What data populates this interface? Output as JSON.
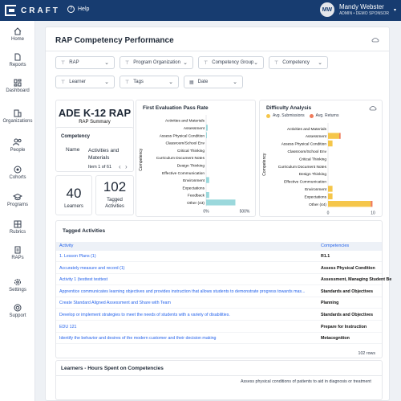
{
  "brand": {
    "name": "CRAFT"
  },
  "topbar": {
    "help_label": "Help",
    "user_initials": "MW",
    "user_name": "Mandy Webster",
    "user_role": "ADMIN • DEMO SPONSOR"
  },
  "sidebar": {
    "items": [
      {
        "label": "Home",
        "icon": "home-icon"
      },
      {
        "label": "Reports",
        "icon": "file-icon"
      },
      {
        "label": "Dashboard",
        "icon": "dashboard-icon"
      },
      {
        "label": "Organizations",
        "icon": "building-icon"
      },
      {
        "label": "People",
        "icon": "people-icon"
      },
      {
        "label": "Cohorts",
        "icon": "cohorts-icon"
      },
      {
        "label": "Programs",
        "icon": "graduation-icon"
      },
      {
        "label": "Rubrics",
        "icon": "grid-icon"
      },
      {
        "label": "RAPs",
        "icon": "document-icon"
      },
      {
        "label": "Settings",
        "icon": "gear-icon"
      },
      {
        "label": "Support",
        "icon": "support-icon"
      }
    ]
  },
  "page": {
    "title": "RAP Competency Performance"
  },
  "filters": [
    "RAP",
    "Program Organization",
    "Competency Group",
    "Competency",
    "Learner",
    "Tags",
    "Date"
  ],
  "summary": {
    "rap_title": "ADE K-12 RAP",
    "rap_subtitle": "RAP Summary",
    "competency_heading": "Competency",
    "name_label": "Name",
    "name_value_line1": "Activities and",
    "name_value_line2": "Materials",
    "pager_text": "Item 1 of 61",
    "learners_value": "40",
    "learners_label": "Learners",
    "tagged_value": "102",
    "tagged_label_1": "Tagged",
    "tagged_label_2": "Activities"
  },
  "chart_data": [
    {
      "type": "bar",
      "orientation": "horizontal",
      "title": "First Evaluation Pass Rate",
      "ylabel": "Competency",
      "categories": [
        "Activities and Materials",
        "Assessment",
        "Assess Physical Condition",
        "Classroom/School Env",
        "Critical Thinking",
        "Curriculum Document Notes",
        "Design Thinking",
        "Effective Communication",
        "Environment",
        "Expectations",
        "Feedback",
        "Other (43)"
      ],
      "values": [
        0,
        20,
        10,
        0,
        0,
        0,
        0,
        0,
        40,
        0,
        40,
        380
      ],
      "xticks": [
        "0%",
        "500%"
      ],
      "xlim": [
        0,
        500
      ],
      "color": "#9bd8dc"
    },
    {
      "type": "bar",
      "orientation": "horizontal",
      "stacked": true,
      "title": "Difficulty Analysis",
      "ylabel": "Competency",
      "categories": [
        "Activities and Materials",
        "Assessment",
        "Assess Physical Condition",
        "Classroom/School Env",
        "Critical Thinking",
        "Curriculum Document Notes",
        "Design Thinking",
        "Effective Communication",
        "Environment",
        "Expectations",
        "Other (44)"
      ],
      "series": [
        {
          "name": "Avg. Submissions",
          "color": "#f5c64a",
          "values": [
            0,
            5,
            2,
            0,
            0,
            0,
            0,
            0,
            2,
            2,
            19
          ]
        },
        {
          "name": "Avg. Returns",
          "color": "#ef7b5b",
          "values": [
            0,
            0.6,
            0,
            0,
            0,
            0,
            0,
            0,
            0,
            0,
            0.8
          ]
        }
      ],
      "xticks": [
        "0",
        "10"
      ],
      "xlim": [
        0,
        20
      ]
    }
  ],
  "tagged": {
    "title": "Tagged Activities",
    "col_activity": "Activity",
    "col_competencies": "Competencies",
    "rows": [
      {
        "activity": "1. Lesson Plans (1)",
        "competency": "R1.1"
      },
      {
        "activity": "Accurately measure and record (1)",
        "competency": "Assess Physical Condition"
      },
      {
        "activity": "Activity 1 (testtest testtest",
        "competency": "Assessment, Managing Student Be"
      },
      {
        "activity": "Apprentice communicates learning objectives and provides instruction that allows students to demonstrate progress towards mas...",
        "competency": "Standards and Objectives"
      },
      {
        "activity": "Create Standard Aligned Assessment and Share with Team",
        "competency": "Planning"
      },
      {
        "activity": "Develop or implement strategies to meet the needs of students with a variety of disabilities.",
        "competency": "Standards and Objectives"
      },
      {
        "activity": "EDU 121",
        "competency": "Prepare for Instruction"
      },
      {
        "activity": "Identify the behavior and desires of the modern customer and their decision making",
        "competency": "Metacognition"
      }
    ],
    "rows_count": "102 rows"
  },
  "hours": {
    "title": "Learners - Hours Spent on Competencies",
    "first_label": "Assess physical conditions of patients to aid in diagnosis or treatment"
  }
}
